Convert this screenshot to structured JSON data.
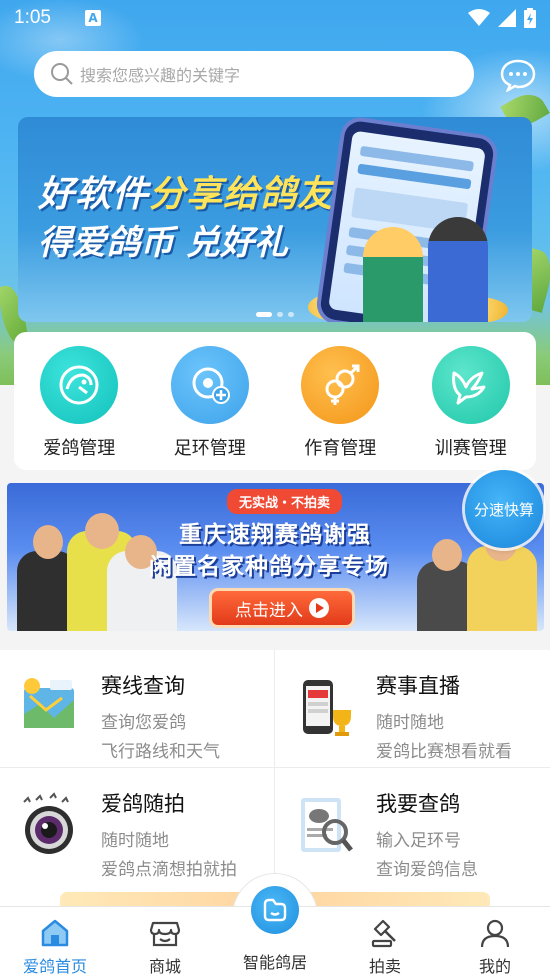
{
  "status_bar": {
    "time": "1:05",
    "notification_badge": "A"
  },
  "search": {
    "placeholder": "搜索您感兴趣的关键字"
  },
  "banner": {
    "line1_a": "好软件",
    "line1_b": "分享给鸽友",
    "line2": "得爱鸽币 兑好礼",
    "carousel_dots": 3,
    "active_dot": 0
  },
  "quick_menu": [
    {
      "label": "爱鸽管理",
      "icon": "pigeon-head-icon",
      "color": "#19cfc9"
    },
    {
      "label": "足环管理",
      "icon": "ring-add-icon",
      "color": "#3da8ef"
    },
    {
      "label": "作育管理",
      "icon": "gender-symbol-icon",
      "color": "#f7a12a"
    },
    {
      "label": "训赛管理",
      "icon": "dove-icon",
      "color": "#2fd1b8"
    }
  ],
  "ad": {
    "tag": "无实战・不拍卖",
    "title1": "重庆速翔赛鸽谢强",
    "title2": "闲置名家种鸽分享专场",
    "button": "点击进入"
  },
  "float_button": {
    "label": "分速快算"
  },
  "services": [
    {
      "title": "赛线查询",
      "desc1": "查询您爱鸽",
      "desc2": "飞行路线和天气",
      "icon": "route-map-icon"
    },
    {
      "title": "赛事直播",
      "desc1": "随时随地",
      "desc2": "爱鸽比赛想看就看",
      "icon": "live-phone-icon"
    },
    {
      "title": "爱鸽随拍",
      "desc1": "随时随地",
      "desc2": "爱鸽点滴想拍就拍",
      "icon": "camera-lens-icon"
    },
    {
      "title": "我要查鸽",
      "desc1": "输入足环号",
      "desc2": "查询爱鸽信息",
      "icon": "pigeon-search-icon"
    }
  ],
  "tabs": [
    {
      "label": "爱鸽首页",
      "active": true
    },
    {
      "label": "商城",
      "active": false
    },
    {
      "label": "智能鸽居",
      "active": false
    },
    {
      "label": "拍卖",
      "active": false
    },
    {
      "label": "我的",
      "active": false
    }
  ],
  "colors": {
    "accent": "#2a8be0",
    "sky": "#3fa7ee"
  }
}
